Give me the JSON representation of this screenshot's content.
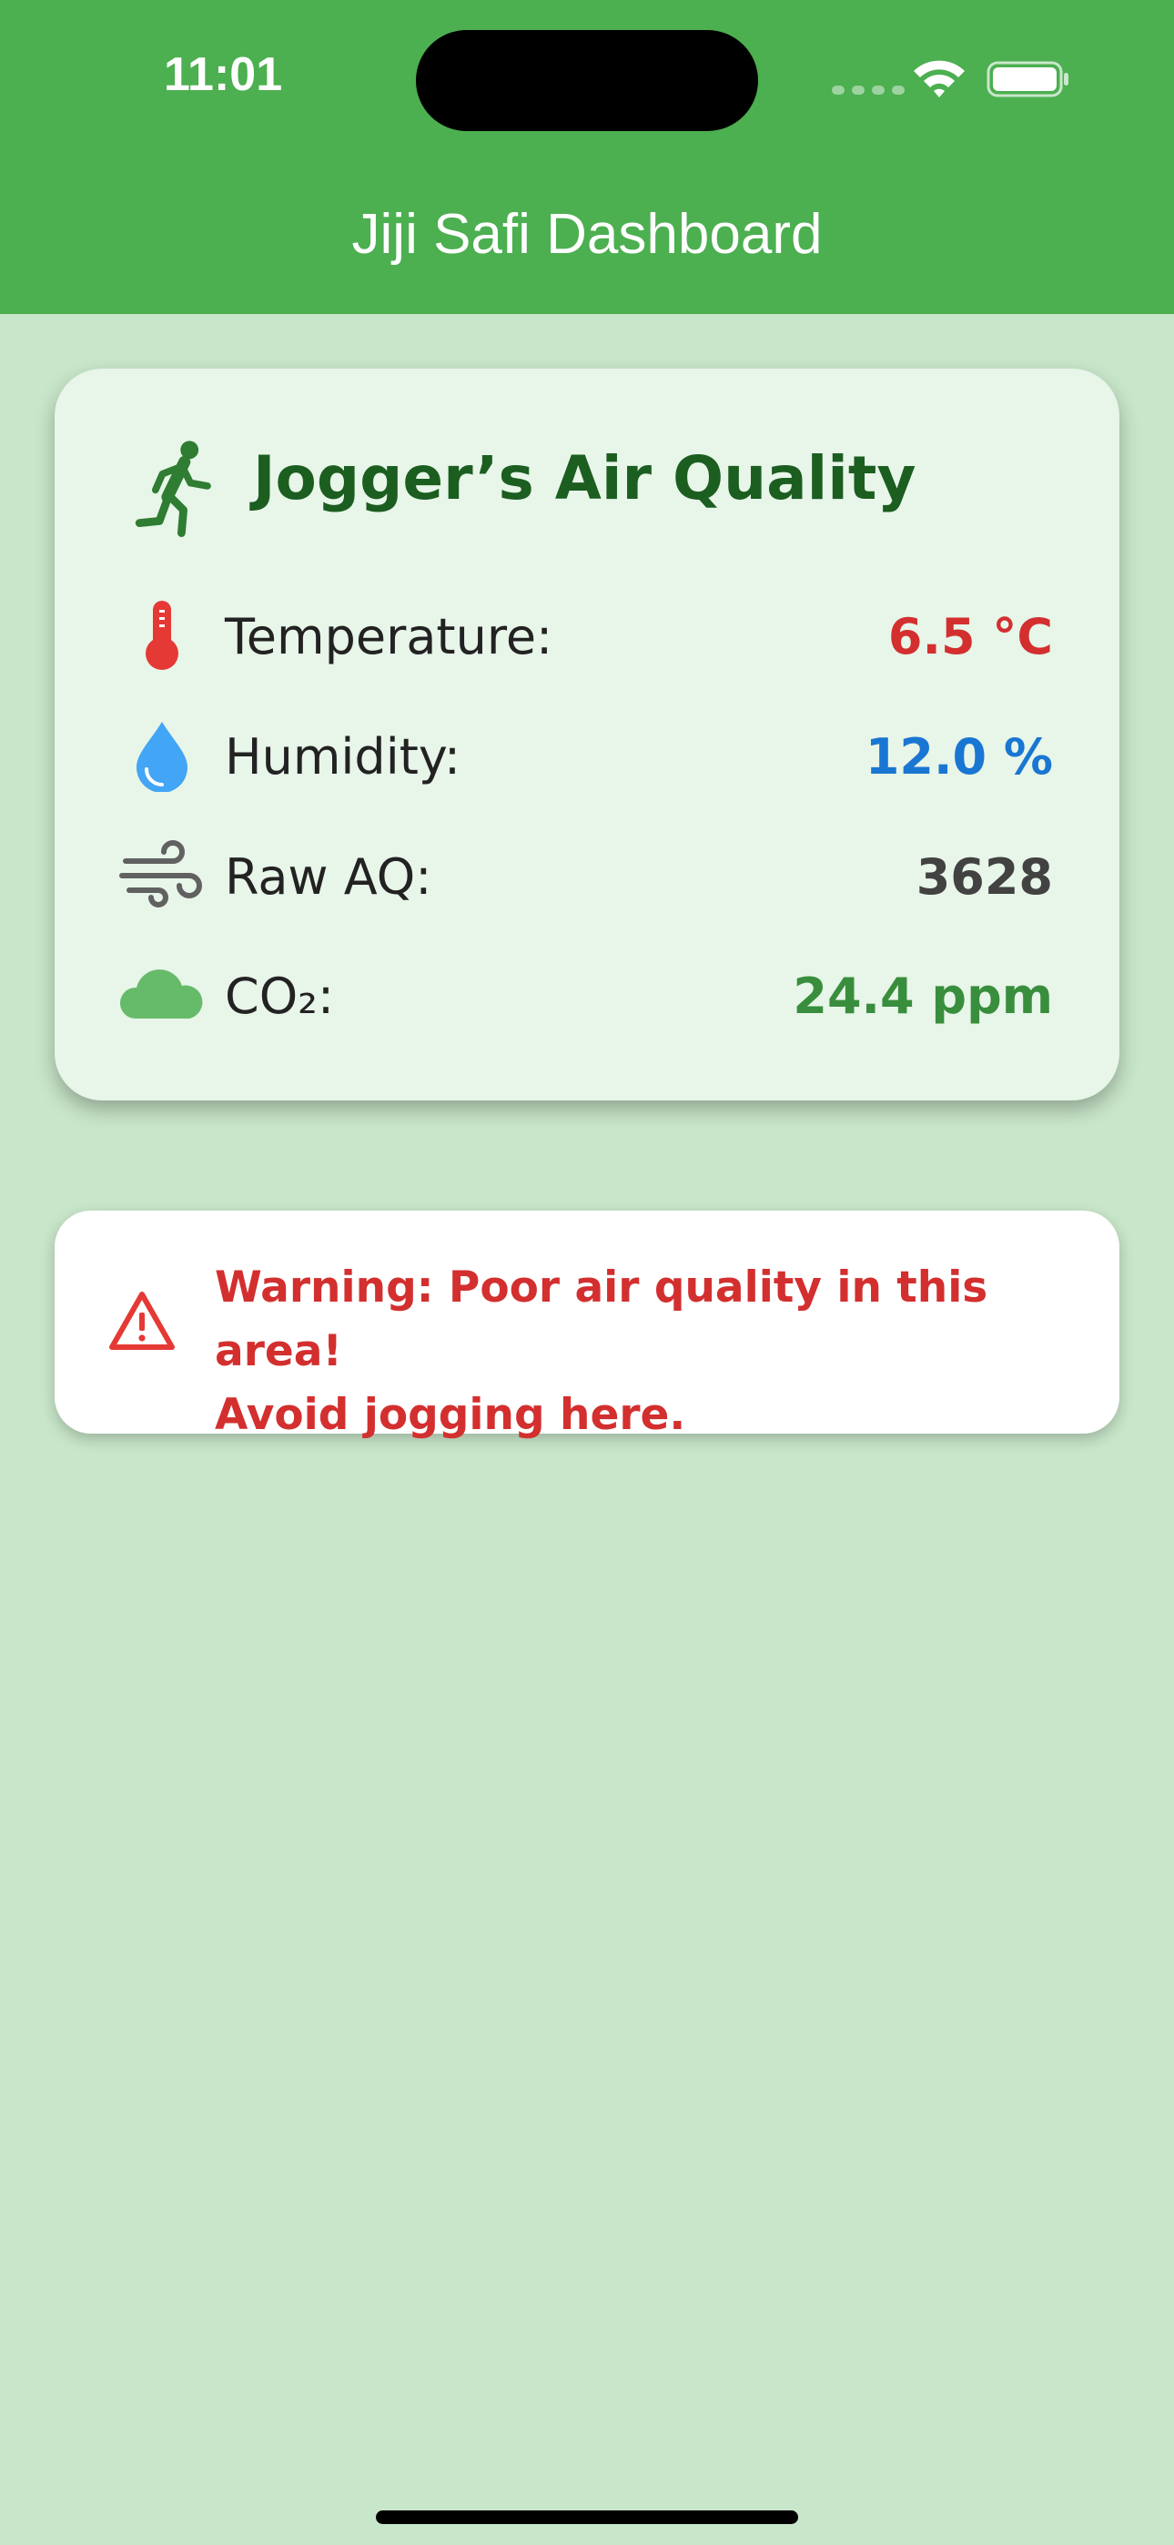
{
  "status_bar": {
    "time": "11:01",
    "icons": [
      "cellular-signal-icon",
      "wifi-icon",
      "battery-icon"
    ]
  },
  "app_bar": {
    "title": "Jiji Safi Dashboard",
    "color": "#4caf50"
  },
  "card": {
    "icon": "running-person-icon",
    "title": "Jogger’s Air Quality",
    "metrics": [
      {
        "icon": "thermometer-icon",
        "label": "Temperature:",
        "value": "6.5 °C",
        "color": "#d32f2f"
      },
      {
        "icon": "water-drop-icon",
        "label": "Humidity:",
        "value": "12.0 %",
        "color": "#1976d2"
      },
      {
        "icon": "wind-icon",
        "label": "Raw AQ:",
        "value": "3628",
        "color": "#424242"
      },
      {
        "icon": "cloud-icon",
        "label": "CO₂:",
        "value": "24.4 ppm",
        "color": "#388e3c"
      }
    ]
  },
  "warning": {
    "icon": "warning-triangle-icon",
    "line1": "Warning: Poor air quality in this area!",
    "line2": "Avoid jogging here.",
    "color": "#d32f2f"
  },
  "colors": {
    "background": "#c8e6c9",
    "card_background": "#e8f5e9",
    "title_green": "#1b5e20"
  }
}
